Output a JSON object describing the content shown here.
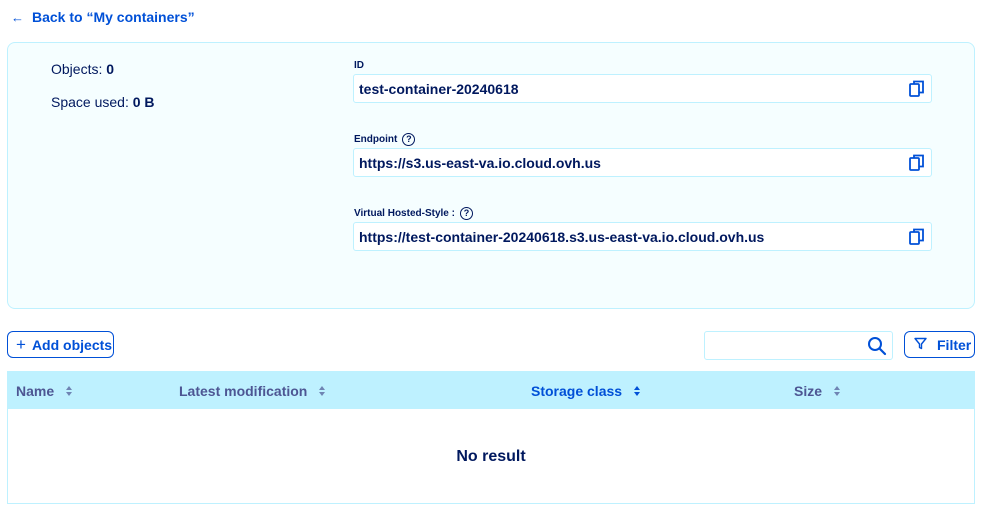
{
  "navigation": {
    "back_arrow": "←",
    "back_label": "Back to “My containers”"
  },
  "stats": {
    "objects_label": "Objects:",
    "objects_value": "0",
    "space_label": "Space used:",
    "space_value": "0 B"
  },
  "fields": {
    "id": {
      "label": "ID",
      "value": "test-container-20240618"
    },
    "endpoint": {
      "label": "Endpoint",
      "value": "https://s3.us-east-va.io.cloud.ovh.us"
    },
    "virtual_hosted": {
      "label": "Virtual Hosted-Style :",
      "value": "https://test-container-20240618.s3.us-east-va.io.cloud.ovh.us"
    }
  },
  "toolbar": {
    "add_plus": "+",
    "add_label": "Add objects",
    "search_value": "",
    "filter_label": "Filter"
  },
  "table": {
    "columns": [
      {
        "label": "Name"
      },
      {
        "label": "Latest modification"
      },
      {
        "label": "Storage class"
      },
      {
        "label": "Size"
      }
    ],
    "empty_text": "No result"
  },
  "icons": {
    "back": "arrow-left-icon",
    "copy": "copy-icon",
    "help": "help-icon",
    "search": "search-icon",
    "filter": "filter-icon",
    "sort": "sort-icon"
  },
  "colors": {
    "primary": "#0050d7",
    "text": "#00185e",
    "header_bg": "#bef1ff",
    "card_bg": "#f5feff"
  }
}
